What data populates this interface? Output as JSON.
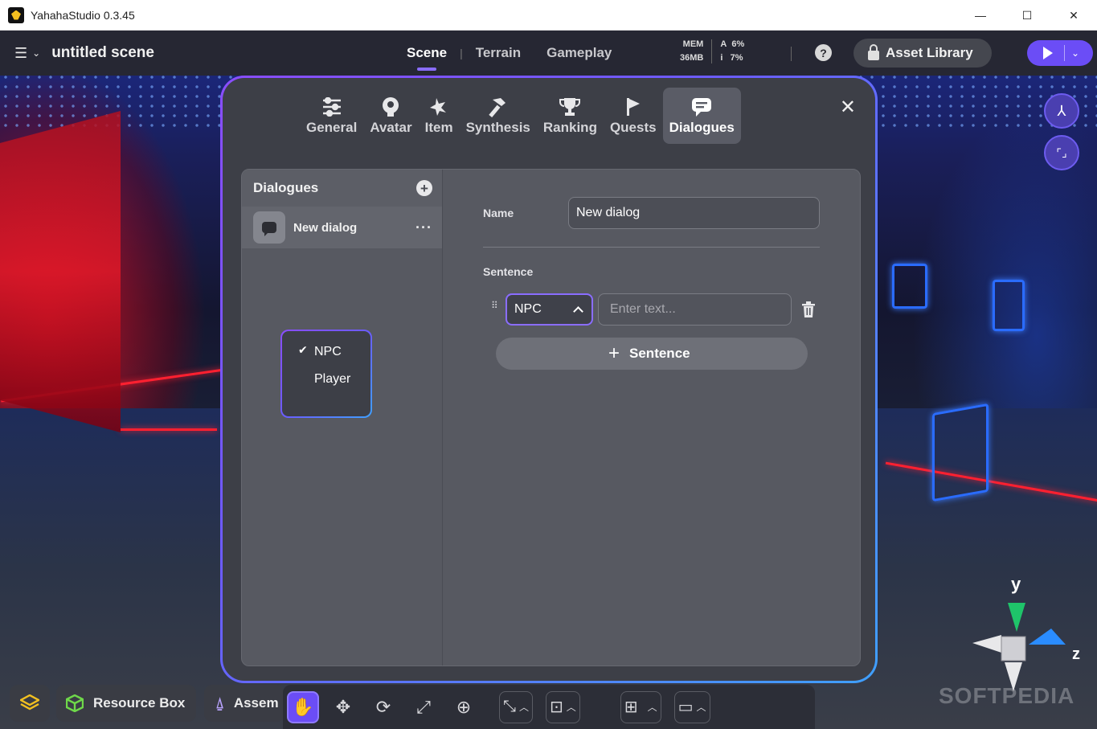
{
  "window": {
    "title": "YahahaStudio 0.3.45",
    "minimize": "—",
    "maximize": "☐",
    "close": "✕"
  },
  "topbar": {
    "scene_name": "untitled scene",
    "modes": [
      "Scene",
      "Terrain",
      "Gameplay"
    ],
    "active_mode": "Scene",
    "mode_separator": "|",
    "stats": {
      "mem_label": "MEM",
      "mem_value": "36MB",
      "a_label": "A",
      "a_value": "6%",
      "i_label": "i",
      "i_value": "7%"
    },
    "help": "?",
    "asset_library": "Asset Library"
  },
  "modal": {
    "tabs": [
      {
        "label": "General",
        "icon": "sliders-icon"
      },
      {
        "label": "Avatar",
        "icon": "avatar-icon"
      },
      {
        "label": "Item",
        "icon": "item-icon"
      },
      {
        "label": "Synthesis",
        "icon": "hammer-icon"
      },
      {
        "label": "Ranking",
        "icon": "trophy-icon"
      },
      {
        "label": "Quests",
        "icon": "flag-icon"
      },
      {
        "label": "Dialogues",
        "icon": "chat-icon"
      }
    ],
    "active_tab": "Dialogues",
    "close": "✕",
    "list": {
      "title": "Dialogues",
      "items": [
        {
          "label": "New dialog"
        }
      ]
    },
    "form": {
      "name_label": "Name",
      "name_value": "New dialog",
      "sentence_label": "Sentence",
      "speaker_value": "NPC",
      "text_placeholder": "Enter text...",
      "add_sentence": "Sentence"
    },
    "dropdown": {
      "options": [
        {
          "label": "NPC",
          "selected": true
        },
        {
          "label": "Player",
          "selected": false
        }
      ]
    }
  },
  "bottom": {
    "resource_box": "Resource Box",
    "assets_partial": "Assem"
  },
  "gizmo": {
    "y": "y",
    "z": "z"
  },
  "watermark": "SOFTPEDIA",
  "colors": {
    "accent": "#6b4df6",
    "gradient_start": "#8a4dff",
    "gradient_end": "#3fa0ff"
  }
}
